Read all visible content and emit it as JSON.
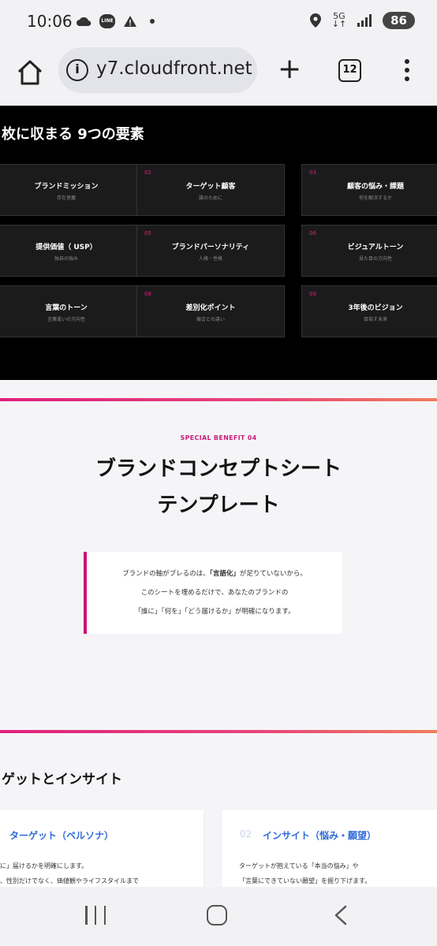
{
  "status_bar": {
    "time": "10:06",
    "line_badge": "LINE",
    "network": "5G",
    "battery": "86"
  },
  "browser": {
    "url": "y7.cloudfront.net",
    "tab_count": "12"
  },
  "dark_section": {
    "title": "枚に収まる 9つの要素",
    "cards": [
      {
        "num": "",
        "title": "ブランドミッション",
        "sub": "存在意義"
      },
      {
        "num": "02",
        "title": "ターゲット顧客",
        "sub": "誰のために"
      },
      {
        "num": "03",
        "title": "顧客の悩み・課題",
        "sub": "何を解決するか"
      },
      {
        "num": "",
        "title": "提供価値（ USP）",
        "sub": "独自の強み"
      },
      {
        "num": "05",
        "title": "ブランドパーソナリティ",
        "sub": "人格・性格"
      },
      {
        "num": "06",
        "title": "ビジュアルトーン",
        "sub": "見た目の方向性"
      },
      {
        "num": "",
        "title": "言葉のトーン",
        "sub": "言葉遣いの方向性"
      },
      {
        "num": "08",
        "title": "差別化ポイント",
        "sub": "競合との違い"
      },
      {
        "num": "09",
        "title": "3年後のビジョン",
        "sub": "目指す未来"
      }
    ]
  },
  "benefit": {
    "label": "SPECIAL BENEFIT 04",
    "title_line1": "ブランドコンセプトシート",
    "title_line2": "テンプレート",
    "quote": {
      "line1_pre": "ブランドの軸がブレるのは、",
      "line1_bold": "「言語化」",
      "line1_post": "が足りていないから。",
      "line2": "このシートを埋めるだけで、あなたのブランドの",
      "line3": "「誰に」「何を」「どう届けるか」が明確になります。"
    }
  },
  "section2": {
    "title": "ゲットとインサイト",
    "card1": {
      "title": "ターゲット（ペルソナ）",
      "text1": "に」届けるかを明確にします。",
      "text2": "、性別だけでなく、価値観やライフスタイルまで"
    },
    "card2": {
      "num": "02",
      "title": "インサイト（悩み・願望）",
      "text1": "ターゲットが抱えている「本当の悩み」や",
      "text2": "「言葉にできていない願望」を掘り下げます。"
    }
  }
}
